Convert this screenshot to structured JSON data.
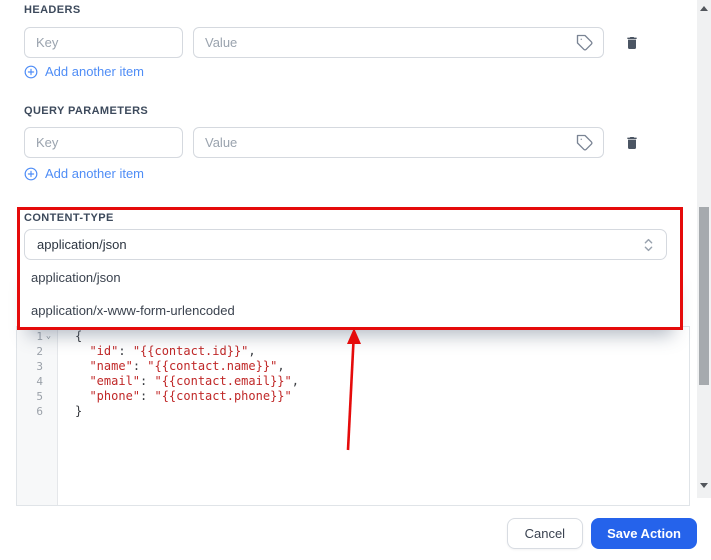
{
  "colors": {
    "annotation_red": "#e50b0b",
    "link_blue": "#4f8df6",
    "primary_button_blue": "#2563eb",
    "code_string_red": "#c02828",
    "section_label_slate": "#3d4a5c"
  },
  "icons": {
    "value_suffix": "tag-icon",
    "row_delete": "trash-icon",
    "add_item": "plus-circle-icon",
    "select_caret": "chevron-up-down-icon",
    "code_fold": "caret-down-icon",
    "scroll_up": "triangle-up-icon",
    "scroll_down": "triangle-down-icon"
  },
  "headers_section": {
    "label": "HEADERS",
    "key_placeholder": "Key",
    "value_placeholder": "Value",
    "add_item_label": "Add another item"
  },
  "query_section": {
    "label": "QUERY PARAMETERS",
    "key_placeholder": "Key",
    "value_placeholder": "Value",
    "add_item_label": "Add another item"
  },
  "content_type": {
    "label": "CONTENT-TYPE",
    "selected_value": "application/json",
    "options": [
      {
        "label": "application/json"
      },
      {
        "label": "application/x-www-form-urlencoded"
      }
    ]
  },
  "editor": {
    "lines": [
      {
        "num": "1",
        "fold": "⌄",
        "open": "{"
      },
      {
        "num": "2",
        "indent": "  ",
        "key": "\"id\"",
        "colon": ": ",
        "val": "\"{{contact.id}}\"",
        "comma": ","
      },
      {
        "num": "3",
        "indent": "  ",
        "key": "\"name\"",
        "colon": ": ",
        "val": "\"{{contact.name}}\"",
        "comma": ","
      },
      {
        "num": "4",
        "indent": "  ",
        "key": "\"email\"",
        "colon": ": ",
        "val": "\"{{contact.email}}\"",
        "comma": ","
      },
      {
        "num": "5",
        "indent": "  ",
        "key": "\"phone\"",
        "colon": ": ",
        "val": "\"{{contact.phone}}\""
      },
      {
        "num": "6",
        "close": "}"
      }
    ]
  },
  "footer": {
    "cancel_label": "Cancel",
    "save_label": "Save Action"
  }
}
